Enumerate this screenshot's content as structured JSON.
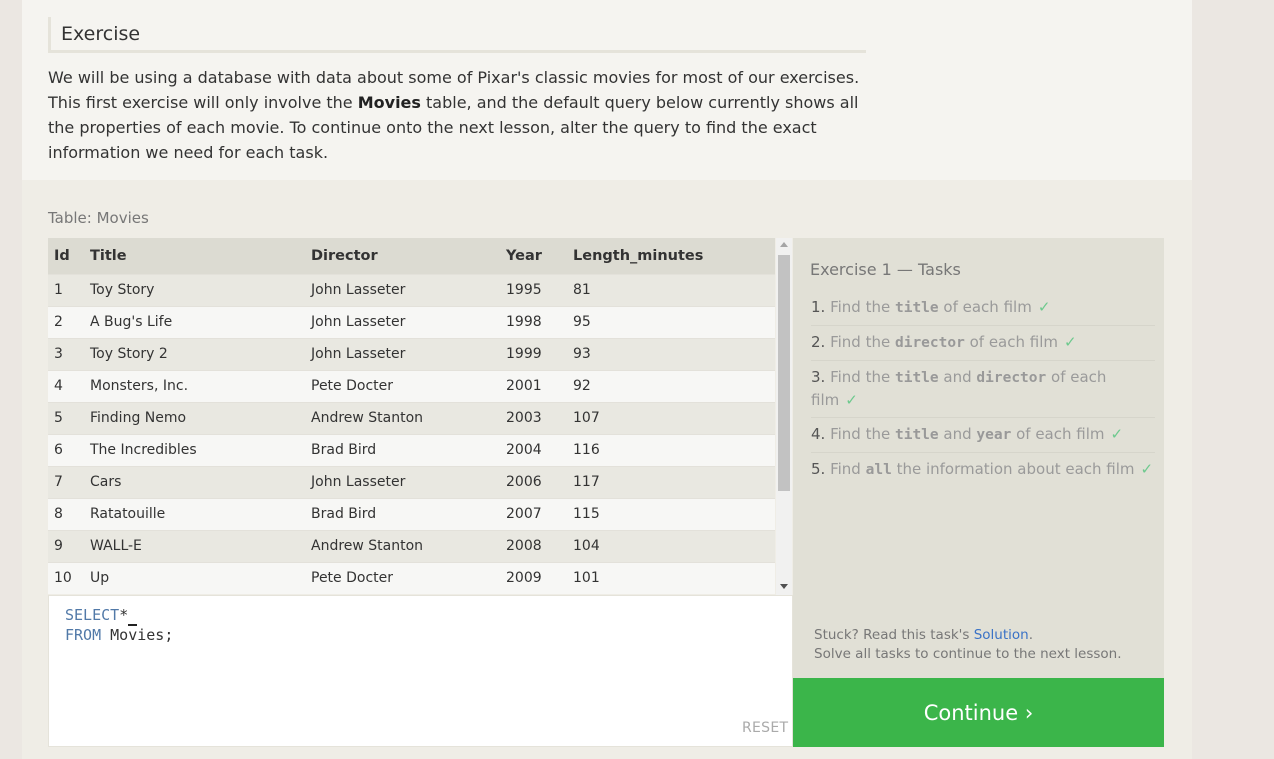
{
  "lesson": {
    "heading": "Exercise",
    "intro_before": "We will be using a database with data about some of Pixar's classic movies for most of our exercises. This first exercise will only involve the ",
    "intro_bold": "Movies",
    "intro_after": " table, and the default query below currently shows all the properties of each movie. To continue onto the next lesson, alter the query to find the exact information we need for each task."
  },
  "table": {
    "label": "Table: Movies",
    "columns": [
      "Id",
      "Title",
      "Director",
      "Year",
      "Length_minutes"
    ],
    "rows": [
      [
        "1",
        "Toy Story",
        "John Lasseter",
        "1995",
        "81"
      ],
      [
        "2",
        "A Bug's Life",
        "John Lasseter",
        "1998",
        "95"
      ],
      [
        "3",
        "Toy Story 2",
        "John Lasseter",
        "1999",
        "93"
      ],
      [
        "4",
        "Monsters, Inc.",
        "Pete Docter",
        "2001",
        "92"
      ],
      [
        "5",
        "Finding Nemo",
        "Andrew Stanton",
        "2003",
        "107"
      ],
      [
        "6",
        "The Incredibles",
        "Brad Bird",
        "2004",
        "116"
      ],
      [
        "7",
        "Cars",
        "John Lasseter",
        "2006",
        "117"
      ],
      [
        "8",
        "Ratatouille",
        "Brad Bird",
        "2007",
        "115"
      ],
      [
        "9",
        "WALL-E",
        "Andrew Stanton",
        "2008",
        "104"
      ],
      [
        "10",
        "Up",
        "Pete Docter",
        "2009",
        "101"
      ]
    ]
  },
  "editor": {
    "line1_keyword": "SELECT",
    "line1_rest": "*",
    "line2_keyword": "FROM",
    "line2_rest": " Movies;",
    "reset_label": "RESET"
  },
  "tasks": {
    "title": "Exercise 1 — Tasks",
    "items": [
      {
        "num": "1.",
        "parts": [
          [
            "text",
            "Find the "
          ],
          [
            "code",
            "title"
          ],
          [
            "text",
            " of each film"
          ]
        ],
        "check": "✓"
      },
      {
        "num": "2.",
        "parts": [
          [
            "text",
            "Find the "
          ],
          [
            "code",
            "director"
          ],
          [
            "text",
            " of each film"
          ]
        ],
        "check": "✓"
      },
      {
        "num": "3.",
        "parts": [
          [
            "text",
            "Find the "
          ],
          [
            "code",
            "title"
          ],
          [
            "text",
            " and "
          ],
          [
            "code",
            "director"
          ],
          [
            "text",
            " of each film"
          ]
        ],
        "check": "✓"
      },
      {
        "num": "4.",
        "parts": [
          [
            "text",
            "Find the "
          ],
          [
            "code",
            "title"
          ],
          [
            "text",
            " and "
          ],
          [
            "code",
            "year"
          ],
          [
            "text",
            " of each film"
          ]
        ],
        "check": "✓"
      },
      {
        "num": "5.",
        "parts": [
          [
            "text",
            "Find "
          ],
          [
            "code",
            "all"
          ],
          [
            "text",
            " the information about each film"
          ]
        ],
        "check": "✓"
      }
    ],
    "stuck_prefix": "Stuck? Read this task's ",
    "solution_link": "Solution",
    "stuck_suffix": ".",
    "solve_all": "Solve all tasks to continue to the next lesson."
  },
  "continue_label": "Continue ›",
  "colors": {
    "accent_green": "#3bb54a",
    "keyword_blue": "#5179a8",
    "link_blue": "#3a72c6",
    "check_green": "#6ec98e"
  }
}
